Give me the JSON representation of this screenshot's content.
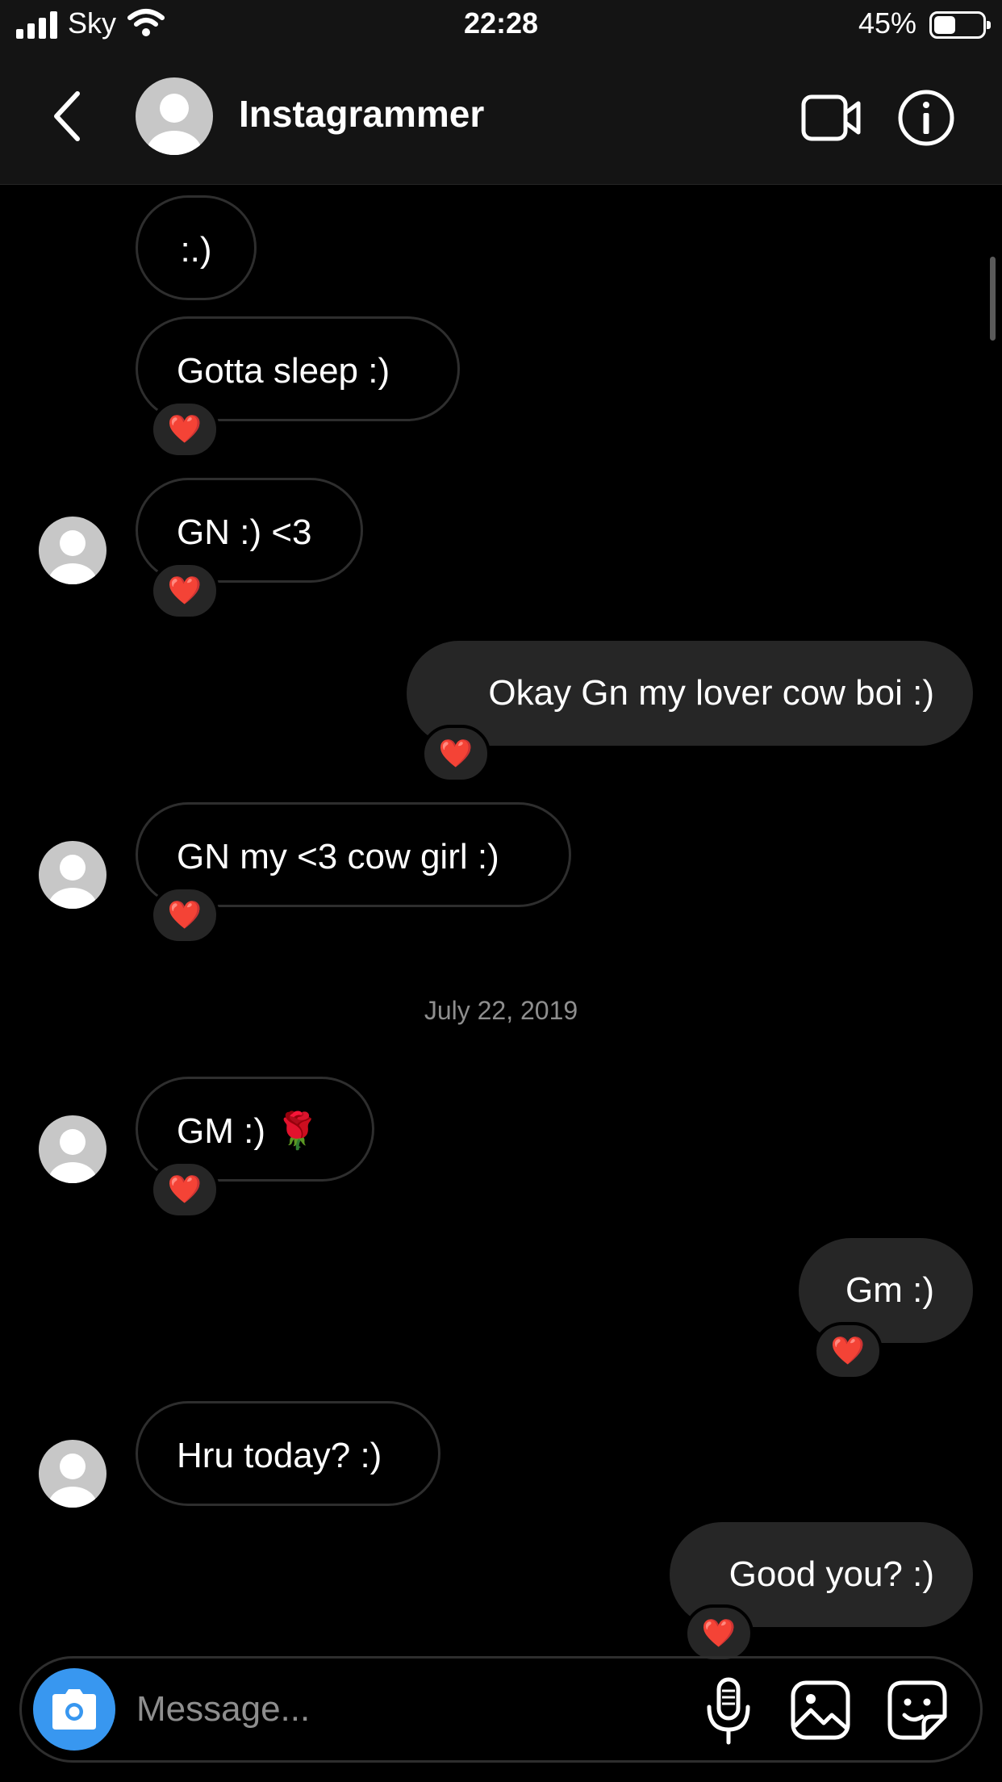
{
  "status_bar": {
    "carrier": "Sky",
    "time": "22:28",
    "battery_percent": "45%",
    "battery_level": 0.45
  },
  "header": {
    "username": "Instagrammer",
    "icons": [
      "back-chevron-icon",
      "avatar",
      "video-call-icon",
      "info-icon"
    ]
  },
  "messages": [
    {
      "side": "in",
      "text": ":.)",
      "reaction": "❤️"
    },
    {
      "side": "in",
      "text": "Gotta sleep  :)",
      "reaction": "❤️"
    },
    {
      "side": "in",
      "text": "GN :) <3",
      "reaction": "❤️"
    },
    {
      "side": "out",
      "text": "Okay Gn my lover cow boi :)",
      "reaction": "❤️"
    },
    {
      "side": "in",
      "text": "GN my <3 cow girl :)",
      "reaction": "❤️"
    },
    {
      "side": "in",
      "text": "GM :) 🌹",
      "reaction": "❤️"
    },
    {
      "side": "out",
      "text": "Gm :)",
      "reaction": "❤️"
    },
    {
      "side": "in",
      "text": "Hru today? :)",
      "reaction": ""
    },
    {
      "side": "out",
      "text": "Good you? :)",
      "reaction": "❤️"
    }
  ],
  "date_separator": "July 22, 2019",
  "composer": {
    "placeholder": "Message...",
    "icons": [
      "camera-icon",
      "microphone-icon",
      "gallery-icon",
      "sticker-icon"
    ]
  },
  "colors": {
    "background": "#000000",
    "header": "#141414",
    "outgoing_bubble": "#262626",
    "incoming_border": "#2e2e2e",
    "camera_button": "#3897f0",
    "secondary_text": "#8e8e8e"
  }
}
